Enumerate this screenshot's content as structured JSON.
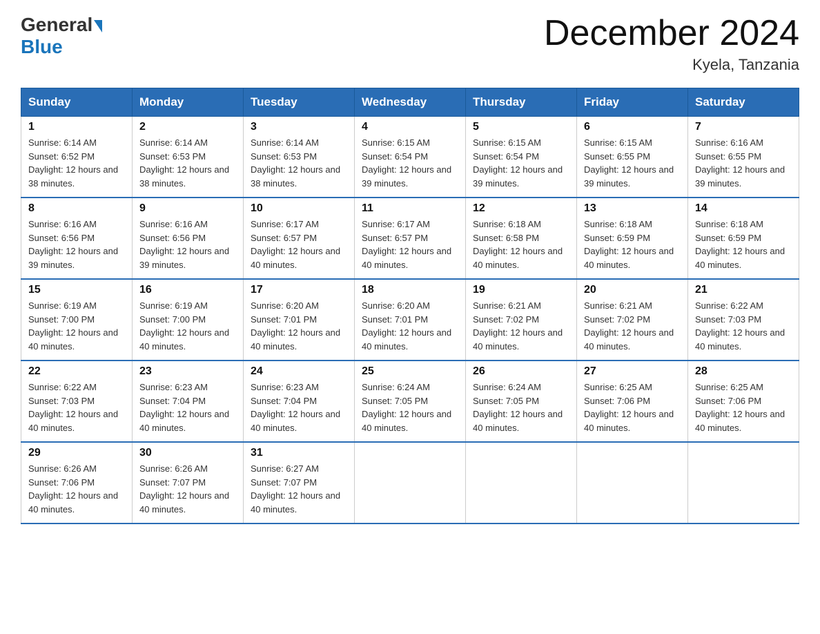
{
  "logo": {
    "general": "General",
    "triangle": "▶",
    "blue": "Blue"
  },
  "title": {
    "month_year": "December 2024",
    "location": "Kyela, Tanzania"
  },
  "header_days": [
    "Sunday",
    "Monday",
    "Tuesday",
    "Wednesday",
    "Thursday",
    "Friday",
    "Saturday"
  ],
  "weeks": [
    [
      {
        "day": "1",
        "sunrise": "6:14 AM",
        "sunset": "6:52 PM",
        "daylight": "12 hours and 38 minutes."
      },
      {
        "day": "2",
        "sunrise": "6:14 AM",
        "sunset": "6:53 PM",
        "daylight": "12 hours and 38 minutes."
      },
      {
        "day": "3",
        "sunrise": "6:14 AM",
        "sunset": "6:53 PM",
        "daylight": "12 hours and 38 minutes."
      },
      {
        "day": "4",
        "sunrise": "6:15 AM",
        "sunset": "6:54 PM",
        "daylight": "12 hours and 39 minutes."
      },
      {
        "day": "5",
        "sunrise": "6:15 AM",
        "sunset": "6:54 PM",
        "daylight": "12 hours and 39 minutes."
      },
      {
        "day": "6",
        "sunrise": "6:15 AM",
        "sunset": "6:55 PM",
        "daylight": "12 hours and 39 minutes."
      },
      {
        "day": "7",
        "sunrise": "6:16 AM",
        "sunset": "6:55 PM",
        "daylight": "12 hours and 39 minutes."
      }
    ],
    [
      {
        "day": "8",
        "sunrise": "6:16 AM",
        "sunset": "6:56 PM",
        "daylight": "12 hours and 39 minutes."
      },
      {
        "day": "9",
        "sunrise": "6:16 AM",
        "sunset": "6:56 PM",
        "daylight": "12 hours and 39 minutes."
      },
      {
        "day": "10",
        "sunrise": "6:17 AM",
        "sunset": "6:57 PM",
        "daylight": "12 hours and 40 minutes."
      },
      {
        "day": "11",
        "sunrise": "6:17 AM",
        "sunset": "6:57 PM",
        "daylight": "12 hours and 40 minutes."
      },
      {
        "day": "12",
        "sunrise": "6:18 AM",
        "sunset": "6:58 PM",
        "daylight": "12 hours and 40 minutes."
      },
      {
        "day": "13",
        "sunrise": "6:18 AM",
        "sunset": "6:59 PM",
        "daylight": "12 hours and 40 minutes."
      },
      {
        "day": "14",
        "sunrise": "6:18 AM",
        "sunset": "6:59 PM",
        "daylight": "12 hours and 40 minutes."
      }
    ],
    [
      {
        "day": "15",
        "sunrise": "6:19 AM",
        "sunset": "7:00 PM",
        "daylight": "12 hours and 40 minutes."
      },
      {
        "day": "16",
        "sunrise": "6:19 AM",
        "sunset": "7:00 PM",
        "daylight": "12 hours and 40 minutes."
      },
      {
        "day": "17",
        "sunrise": "6:20 AM",
        "sunset": "7:01 PM",
        "daylight": "12 hours and 40 minutes."
      },
      {
        "day": "18",
        "sunrise": "6:20 AM",
        "sunset": "7:01 PM",
        "daylight": "12 hours and 40 minutes."
      },
      {
        "day": "19",
        "sunrise": "6:21 AM",
        "sunset": "7:02 PM",
        "daylight": "12 hours and 40 minutes."
      },
      {
        "day": "20",
        "sunrise": "6:21 AM",
        "sunset": "7:02 PM",
        "daylight": "12 hours and 40 minutes."
      },
      {
        "day": "21",
        "sunrise": "6:22 AM",
        "sunset": "7:03 PM",
        "daylight": "12 hours and 40 minutes."
      }
    ],
    [
      {
        "day": "22",
        "sunrise": "6:22 AM",
        "sunset": "7:03 PM",
        "daylight": "12 hours and 40 minutes."
      },
      {
        "day": "23",
        "sunrise": "6:23 AM",
        "sunset": "7:04 PM",
        "daylight": "12 hours and 40 minutes."
      },
      {
        "day": "24",
        "sunrise": "6:23 AM",
        "sunset": "7:04 PM",
        "daylight": "12 hours and 40 minutes."
      },
      {
        "day": "25",
        "sunrise": "6:24 AM",
        "sunset": "7:05 PM",
        "daylight": "12 hours and 40 minutes."
      },
      {
        "day": "26",
        "sunrise": "6:24 AM",
        "sunset": "7:05 PM",
        "daylight": "12 hours and 40 minutes."
      },
      {
        "day": "27",
        "sunrise": "6:25 AM",
        "sunset": "7:06 PM",
        "daylight": "12 hours and 40 minutes."
      },
      {
        "day": "28",
        "sunrise": "6:25 AM",
        "sunset": "7:06 PM",
        "daylight": "12 hours and 40 minutes."
      }
    ],
    [
      {
        "day": "29",
        "sunrise": "6:26 AM",
        "sunset": "7:06 PM",
        "daylight": "12 hours and 40 minutes."
      },
      {
        "day": "30",
        "sunrise": "6:26 AM",
        "sunset": "7:07 PM",
        "daylight": "12 hours and 40 minutes."
      },
      {
        "day": "31",
        "sunrise": "6:27 AM",
        "sunset": "7:07 PM",
        "daylight": "12 hours and 40 minutes."
      },
      null,
      null,
      null,
      null
    ]
  ]
}
